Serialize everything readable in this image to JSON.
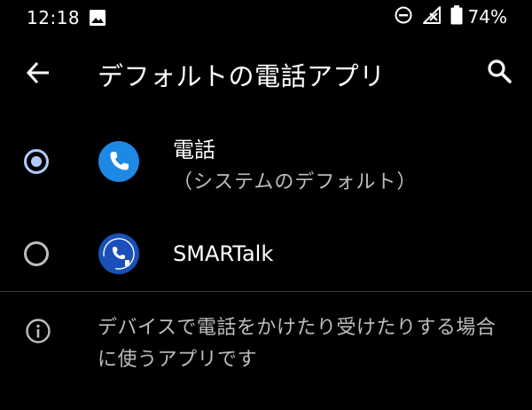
{
  "status_bar": {
    "time": "12:18",
    "battery_percent": "74%",
    "icons": [
      "photo-icon",
      "do-not-disturb-icon",
      "no-signal-icon",
      "battery-icon"
    ]
  },
  "app_bar": {
    "title": "デフォルトの電話アプリ",
    "back_icon": "arrow-back-icon",
    "search_icon": "search-icon"
  },
  "options": [
    {
      "name": "電話",
      "subtitle": "（システムのデフォルト）",
      "selected": true,
      "icon": "phone-app-icon"
    },
    {
      "name": "SMARTalk",
      "selected": false,
      "icon": "smartalk-app-icon"
    }
  ],
  "footer": {
    "icon": "info-icon",
    "text": "デバイスで電話をかけたり受けたりする場合に使うアプリです"
  },
  "colors": {
    "background": "#000000",
    "radio_selected": "#aecbfa",
    "radio_unselected": "#bdbdbd",
    "phone_icon_bg": "#1e88e5",
    "smartalk_icon_bg": "#1a4fb8",
    "secondary_text": "#bdbdbd",
    "divider": "#3a3a3a"
  }
}
